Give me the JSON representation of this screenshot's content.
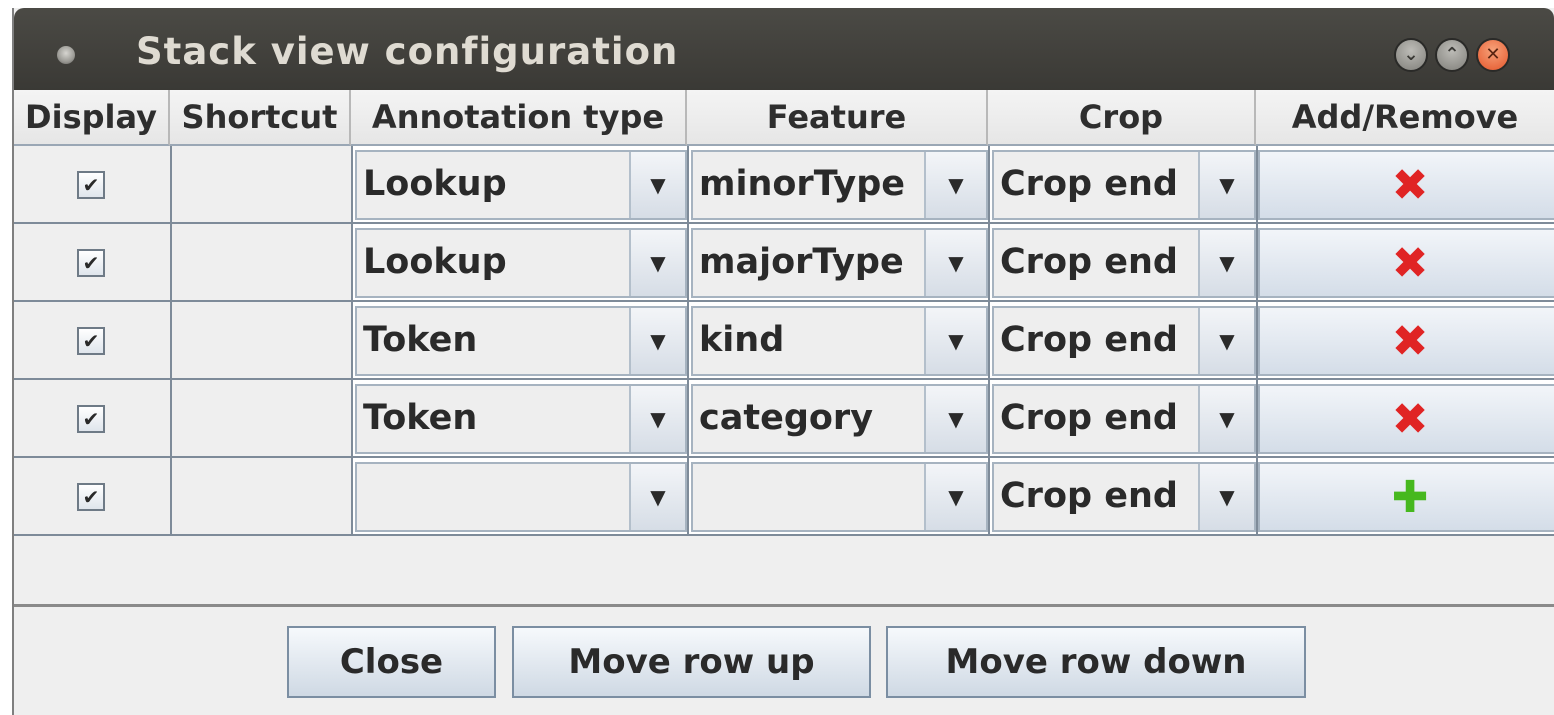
{
  "window": {
    "title": "Stack view configuration",
    "controls": {
      "minimize": "⌄",
      "maximize": "⌃",
      "close": "✕"
    }
  },
  "table": {
    "headers": [
      "Display",
      "Shortcut",
      "Annotation type",
      "Feature",
      "Crop",
      "Add/Remove"
    ],
    "rows": [
      {
        "display": "✔",
        "shortcut": "",
        "annotation_type": "Lookup",
        "feature": "minorType",
        "crop": "Crop end",
        "action": "✖",
        "action_kind": "remove"
      },
      {
        "display": "✔",
        "shortcut": "",
        "annotation_type": "Lookup",
        "feature": "majorType",
        "crop": "Crop end",
        "action": "✖",
        "action_kind": "remove"
      },
      {
        "display": "✔",
        "shortcut": "",
        "annotation_type": "Token",
        "feature": "kind",
        "crop": "Crop end",
        "action": "✖",
        "action_kind": "remove"
      },
      {
        "display": "✔",
        "shortcut": "",
        "annotation_type": "Token",
        "feature": "category",
        "crop": "Crop end",
        "action": "✖",
        "action_kind": "remove"
      },
      {
        "display": "✔",
        "shortcut": "",
        "annotation_type": "",
        "feature": "",
        "crop": "Crop end",
        "action": "✚",
        "action_kind": "add"
      }
    ],
    "dropdown_arrow": "▼"
  },
  "buttons": {
    "close": "Close",
    "move_up": "Move row up",
    "move_down": "Move row down"
  },
  "colors": {
    "remove": "#e02424",
    "add": "#46b81e",
    "titlebar": "#3f3e3a"
  }
}
